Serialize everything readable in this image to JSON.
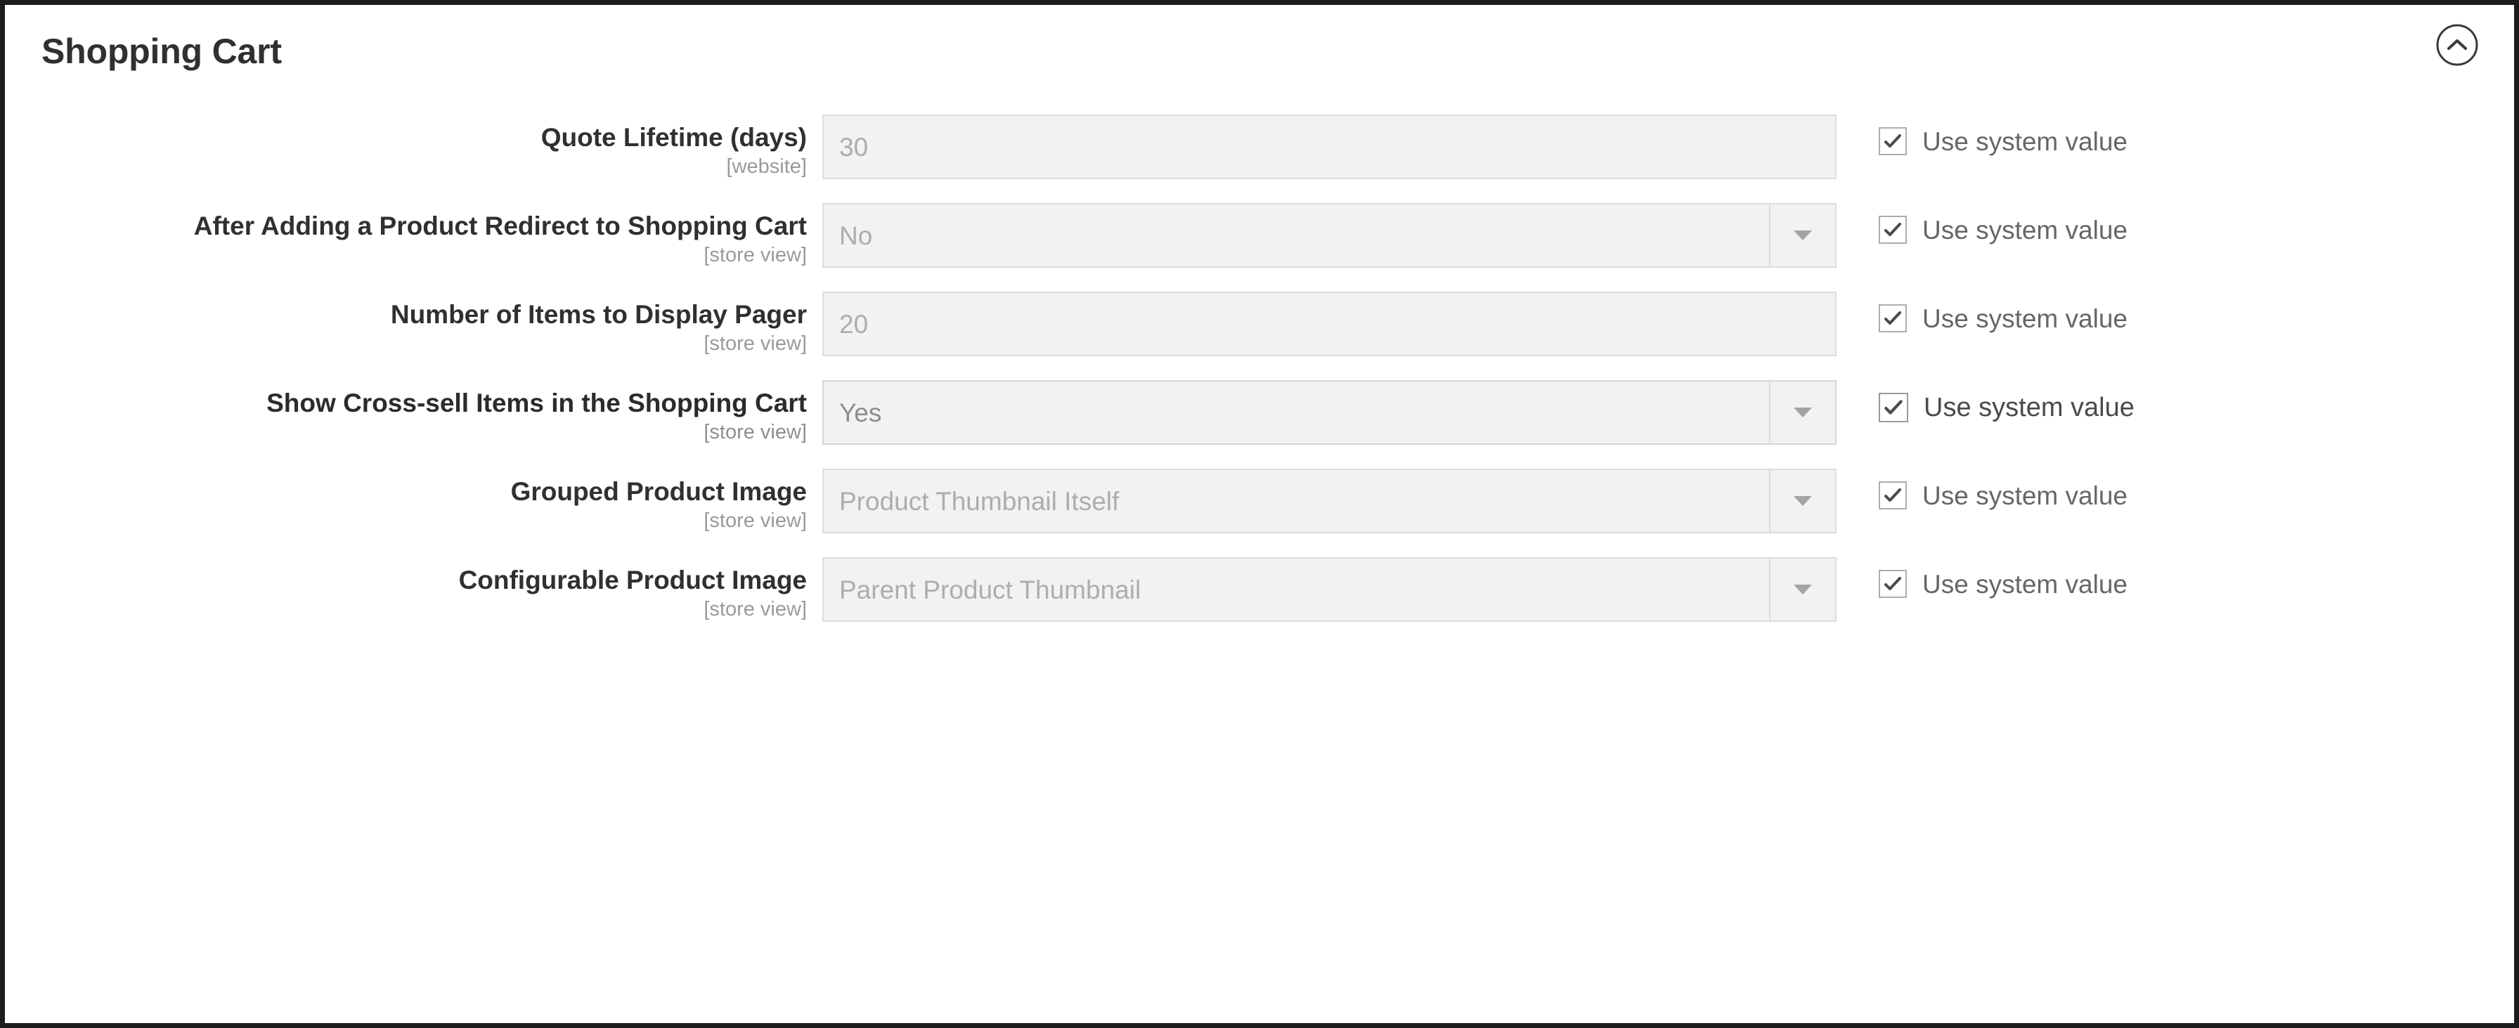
{
  "section": {
    "title": "Shopping Cart",
    "collapse_icon": "chevron-up-circle-icon",
    "collapse_state": "expanded"
  },
  "colors": {
    "page_background": "#ffffff",
    "outer_border": "#1c1c1c",
    "title_text": "#303030",
    "label_text": "#303030",
    "scope_text": "#9a9a9a",
    "field_background": "#f2f2f2",
    "field_border": "#dcdcdc",
    "field_value_text": "#adadad",
    "checkbox_border": "#adadad",
    "checkmark": "#514943",
    "system_value_label": "#666666",
    "select_arrow": "#a6a29e"
  },
  "system_value": {
    "label": "Use system value",
    "checked": true,
    "checkbox_icon": "checkmark-icon"
  },
  "fields": [
    {
      "label": "Quote Lifetime (days)",
      "scope": "[website]",
      "type": "text",
      "value": "30",
      "disabled": true,
      "use_system_value": true,
      "emphasis": false
    },
    {
      "label": "After Adding a Product Redirect to Shopping Cart",
      "scope": "[store view]",
      "type": "select",
      "value": "No",
      "dropdown_icon": "caret-down-icon",
      "disabled": true,
      "use_system_value": true,
      "emphasis": false
    },
    {
      "label": "Number of Items to Display Pager",
      "scope": "[store view]",
      "type": "text",
      "value": "20",
      "disabled": true,
      "use_system_value": true,
      "emphasis": false
    },
    {
      "label": "Show Cross-sell Items in the Shopping Cart",
      "scope": "[store view]",
      "type": "select",
      "value": "Yes",
      "dropdown_icon": "caret-down-icon",
      "disabled": true,
      "use_system_value": true,
      "emphasis": true
    },
    {
      "label": "Grouped Product Image",
      "scope": "[store view]",
      "type": "select",
      "value": "Product Thumbnail Itself",
      "dropdown_icon": "caret-down-icon",
      "disabled": true,
      "use_system_value": true,
      "emphasis": false
    },
    {
      "label": "Configurable Product Image",
      "scope": "[store view]",
      "type": "select",
      "value": "Parent Product Thumbnail",
      "dropdown_icon": "caret-down-icon",
      "disabled": true,
      "use_system_value": true,
      "emphasis": false
    }
  ]
}
